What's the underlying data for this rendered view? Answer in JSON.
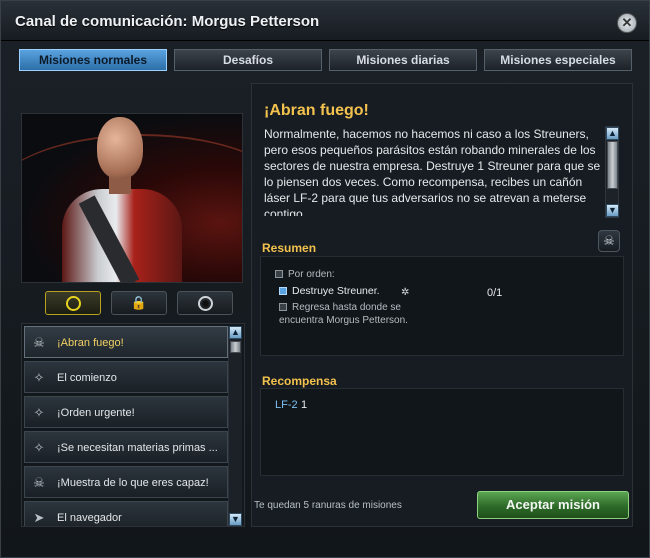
{
  "window": {
    "title": "Canal de comunicación: Morgus Petterson",
    "close_icon": "close-icon"
  },
  "tabs": [
    {
      "label": "Misiones normales",
      "active": true
    },
    {
      "label": "Desafíos",
      "active": false
    },
    {
      "label": "Misiones diarias",
      "active": false
    },
    {
      "label": "Misiones especiales",
      "active": false
    }
  ],
  "filters": {
    "items": [
      {
        "icon": "circle-icon",
        "active": true
      },
      {
        "icon": "lock-icon",
        "active": false
      },
      {
        "icon": "record-icon",
        "active": false
      }
    ]
  },
  "missions": [
    {
      "label": "¡Abran fuego!",
      "icon": "skull-icon",
      "selected": true
    },
    {
      "label": "El comienzo",
      "icon": "compass-icon",
      "selected": false
    },
    {
      "label": "¡Orden urgente!",
      "icon": "compass-icon",
      "selected": false
    },
    {
      "label": "¡Se necesitan materias primas ...",
      "icon": "compass-icon",
      "selected": false
    },
    {
      "label": "¡Muestra de lo que eres capaz!",
      "icon": "skull-icon",
      "selected": false
    },
    {
      "label": "El navegador",
      "icon": "ship-icon",
      "selected": false
    }
  ],
  "mission": {
    "title": "¡Abran fuego!",
    "description": "Normalmente, hacemos no hacemos ni caso a los Streuners, pero esos pequeños parásitos están robando minerales de los sectores de nuestra empresa. Destruye 1 Streuner para que se lo piensen dos veces. Como recompensa, recibes un cañón láser LF-2 para que tus adversarios no se atrevan a meterse contigo."
  },
  "summary": {
    "label": "Resumen",
    "order_label": "Por orden:",
    "task": "Destruye Streuner.",
    "progress": "0/1",
    "return_text": "Regresa hasta donde se encuentra Morgus Petterson."
  },
  "reward": {
    "label": "Recompensa",
    "item": "LF-2",
    "qty": "1"
  },
  "footer": {
    "status": "Te quedan 5 ranuras de misiones",
    "accept_label": "Aceptar misión"
  },
  "colors": {
    "accent_gold": "#f3c24e",
    "tab_active": "#5aa3e0",
    "accept_green": "#3d8a36"
  }
}
